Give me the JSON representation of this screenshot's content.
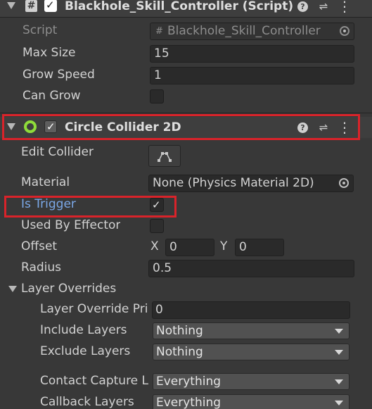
{
  "script_component": {
    "title": "Blackhole_Skill_Controller (Script)",
    "hash_glyph": "#",
    "icons": [
      "hash-script-icon",
      "help-icon",
      "preset-icon",
      "kebab-menu-icon"
    ],
    "fields": {
      "script_label": "Script",
      "script_value": "Blackhole_Skill_Controller",
      "max_size_label": "Max Size",
      "max_size_value": "15",
      "grow_speed_label": "Grow Speed",
      "grow_speed_value": "1",
      "can_grow_label": "Can Grow",
      "can_grow_checked": false
    }
  },
  "collider_component": {
    "title": "Circle Collider 2D",
    "enabled": true,
    "icons": [
      "circle-collider-icon",
      "help-icon",
      "preset-icon",
      "kebab-menu-icon"
    ],
    "fields": {
      "edit_collider_label": "Edit Collider",
      "material_label": "Material",
      "material_value": "None (Physics Material 2D)",
      "is_trigger_label": "Is Trigger",
      "is_trigger_checked": true,
      "used_by_effector_label": "Used By Effector",
      "used_by_effector_checked": false,
      "offset_label": "Offset",
      "offset_x_label": "X",
      "offset_x_value": "0",
      "offset_y_label": "Y",
      "offset_y_value": "0",
      "radius_label": "Radius",
      "radius_value": "0.5"
    },
    "layer_overrides": {
      "label": "Layer Overrides",
      "priority_label": "Layer Override Pri",
      "priority_value": "0",
      "include_label": "Include Layers",
      "include_value": "Nothing",
      "exclude_label": "Exclude Layers",
      "exclude_value": "Nothing",
      "contact_capture_label": "Contact Capture L",
      "contact_capture_value": "Everything",
      "callback_label": "Callback Layers",
      "callback_value": "Everything"
    }
  },
  "glyphs": {
    "check": "✓",
    "help": "?",
    "preset": "⇌",
    "kebab": "⋮"
  },
  "colors": {
    "panel_bg": "#383838",
    "header_bg": "#3e3e3e",
    "field_bg": "#2a2a2a",
    "highlight_red": "#d9232a",
    "trigger_label_blue": "#7ba8e8",
    "collider_icon_green": "#8fdc3a"
  }
}
